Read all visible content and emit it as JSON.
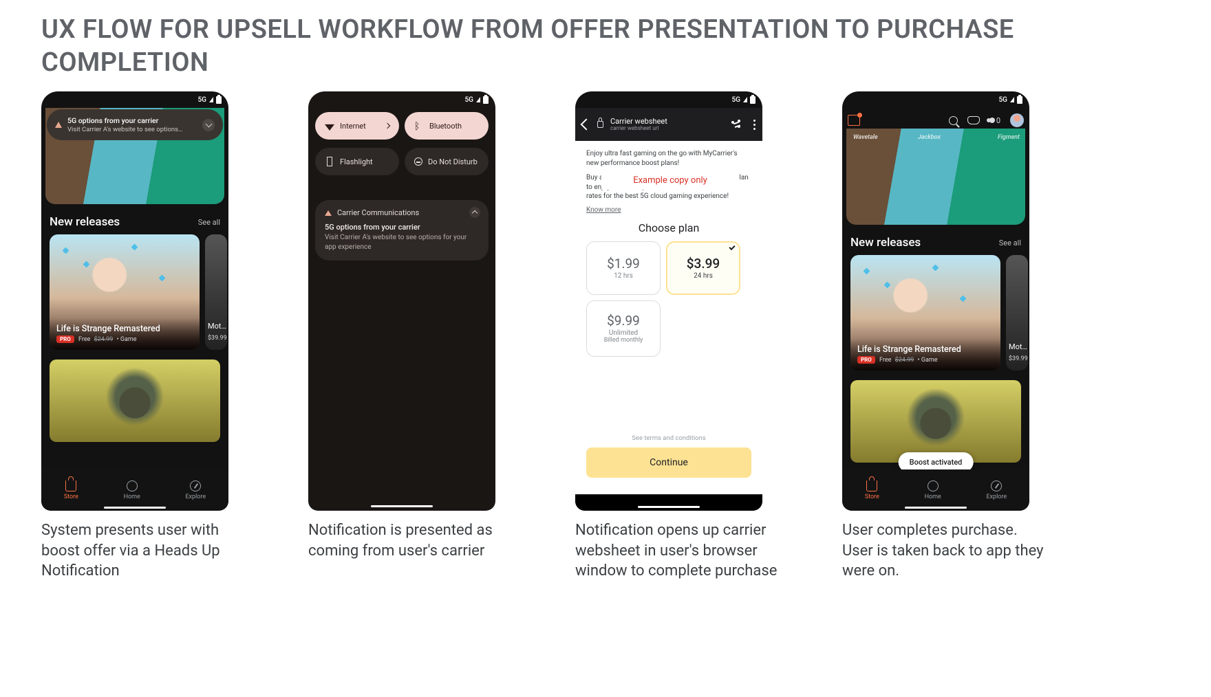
{
  "page_title": "UX FLOW FOR UPSELL WORKFLOW FROM OFFER PRESENTATION TO PURCHASE COMPLETION",
  "status": {
    "net": "5G"
  },
  "captions": {
    "s1": "System presents user with boost offer via a Heads Up Notification",
    "s2": "Notification is presented as coming from user's carrier",
    "s3": "Notification opens up carrier websheet in user's browser window to complete purchase",
    "s4": "User completes purchase. User is taken back to app they were on."
  },
  "store": {
    "section": "New releases",
    "see_all": "See all",
    "game1_title": "Life is Strange Remastered",
    "game1_badge": "PRO",
    "game1_free": "Free",
    "game1_old_price": "$24.99",
    "game1_type": "Game",
    "game2_title": "Mot…",
    "game2_price": "$39.99",
    "nav": {
      "store": "Store",
      "home": "Home",
      "explore": "Explore"
    },
    "people_count": "0",
    "banner_labels": {
      "a": "Wavetale",
      "b": "Jackbox",
      "c": "Figment"
    }
  },
  "hun": {
    "title": "5G options from your carrier",
    "body": "Visit Carrier A's website to see options…"
  },
  "qs": {
    "internet": "Internet",
    "bluetooth": "Bluetooth",
    "flashlight": "Flashlight",
    "dnd": "Do Not Disturb"
  },
  "notif": {
    "app": "Carrier Communications",
    "title": "5G options from your carrier",
    "body": "Visit Carrier A's website to see options for your app experience"
  },
  "websheet": {
    "bar_title": "Carrier websheet",
    "bar_sub": "carrier websheet url",
    "intro": "Enjoy ultra fast gaming on the go with MyCarrier's new performance boost plans!",
    "intro2": "Buy a pass for a boost or subscribe to a monthly plan to enjoy unlimited performance at the best refresh rates for the best 5G cloud gaming experience!",
    "example_tag": "Example copy only",
    "know_more": "Know more",
    "choose": "Choose plan",
    "plan1_price": "$1.99",
    "plan1_dur": "12 hrs",
    "plan2_price": "$3.99",
    "plan2_dur": "24 hrs",
    "plan3_price": "$9.99",
    "plan3_dur": "Unlimited",
    "plan3_sub": "Billed monthly",
    "terms": "See terms and conditions",
    "continue": "Continue"
  },
  "boost_chip": "Boost activated"
}
